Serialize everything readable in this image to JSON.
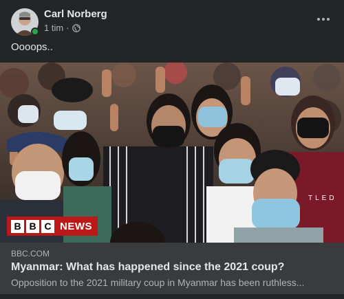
{
  "post": {
    "author": "Carl Norberg",
    "timestamp": "1 tim",
    "separator": "·",
    "privacy_icon": "globe-icon",
    "more_icon": "more-horizontal-icon",
    "text": "Oooops..",
    "online": true
  },
  "image": {
    "logo_box_letters": [
      "B",
      "B",
      "C"
    ],
    "logo_word": "NEWS",
    "sign_text": "TLED"
  },
  "link": {
    "domain": "BBC.COM",
    "title": "Myanmar: What has happened since the 2021 coup?",
    "description": "Opposition to the 2021 military coup in Myanmar has been ruthless..."
  },
  "colors": {
    "background": "#242526",
    "preview_background": "#3a3b3c",
    "online": "#31a24c",
    "bbc_red": "#bb1919"
  }
}
